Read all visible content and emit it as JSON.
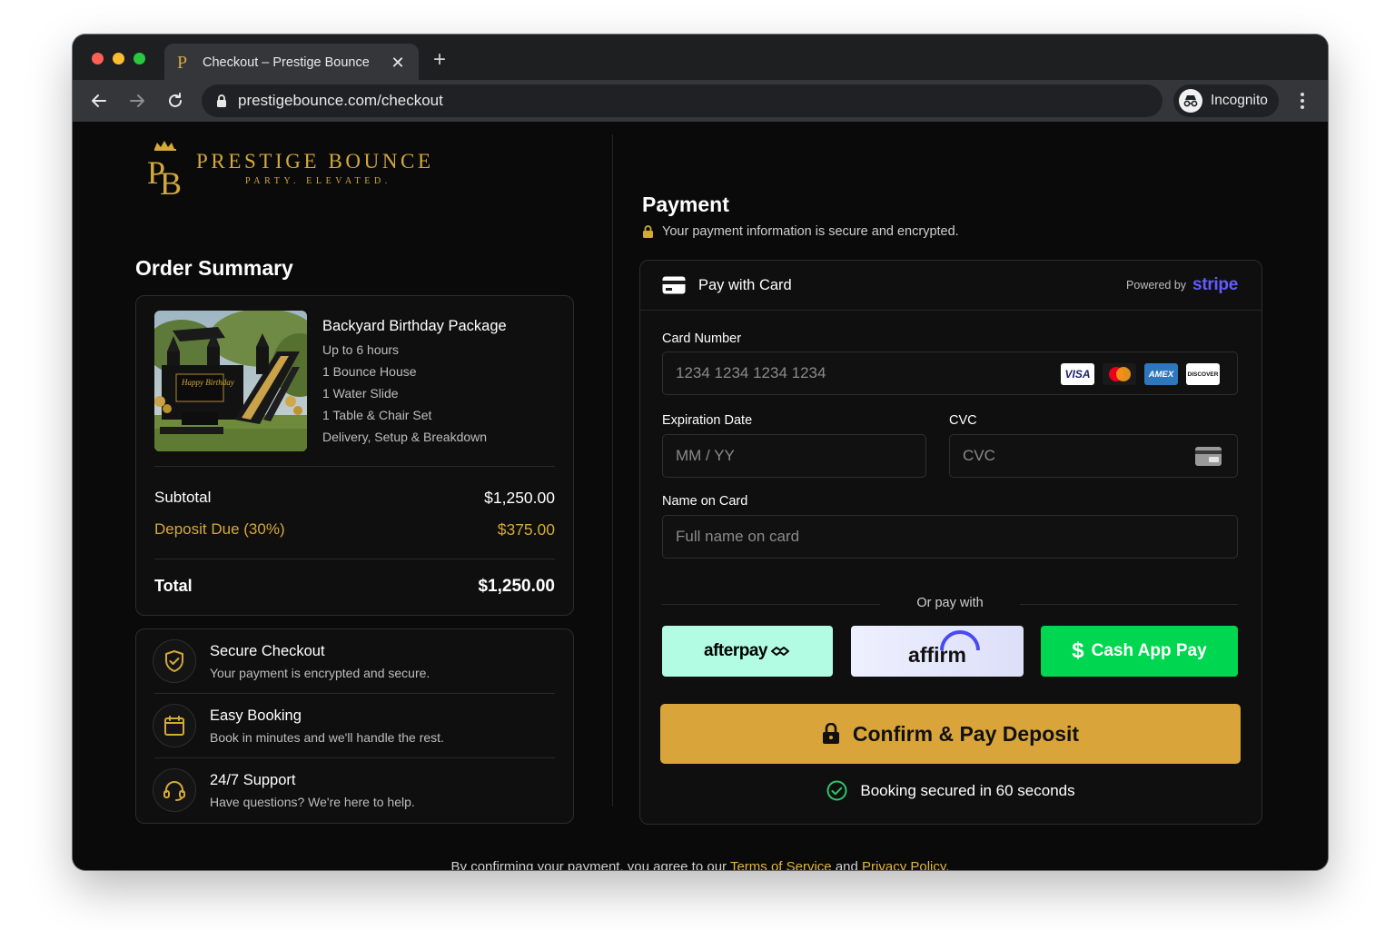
{
  "browser": {
    "tab_title": "Checkout – Prestige Bounce",
    "tab_favicon": "P",
    "url": "prestigebounce.com/checkout",
    "incognito_label": "Incognito"
  },
  "brand": {
    "name": "PRESTIGE BOUNCE",
    "tagline": "PARTY. ELEVATED.",
    "monogram_letters": "PB",
    "gold": "#d4a93a"
  },
  "order_summary": {
    "heading": "Order Summary",
    "product": {
      "title": "Backyard Birthday Package",
      "details": [
        "Up to 6 hours",
        "1 Bounce House",
        "1 Water Slide",
        "1 Table & Chair Set",
        "Delivery, Setup & Breakdown"
      ],
      "image_sign": "Happy Birthday"
    },
    "subtotal_label": "Subtotal",
    "subtotal_value": "$1,250.00",
    "deposit_label": "Deposit Due (30%)",
    "deposit_value": "$375.00",
    "total_label": "Total",
    "total_value": "$1,250.00"
  },
  "features": [
    {
      "icon": "shield-check-icon",
      "title": "Secure Checkout",
      "subtitle": "Your payment is encrypted and secure."
    },
    {
      "icon": "calendar-icon",
      "title": "Easy Booking",
      "subtitle": "Book in minutes and we'll handle the rest."
    },
    {
      "icon": "headset-icon",
      "title": "24/7 Support",
      "subtitle": "Have questions? We're here to help."
    }
  ],
  "payment": {
    "heading": "Payment",
    "secure_note": "Your payment information is secure and encrypted.",
    "card_header": "Pay with Card",
    "powered_by": "Powered by",
    "stripe": "stripe",
    "card_number_label": "Card Number",
    "card_number_placeholder": "1234 1234 1234 1234",
    "card_brands": [
      "VISA",
      "Mastercard",
      "AMEX",
      "DISCOVER"
    ],
    "expiry_label": "Expiration Date",
    "expiry_placeholder": "MM / YY",
    "cvc_label": "CVC",
    "cvc_placeholder": "CVC",
    "name_label": "Name on Card",
    "name_placeholder": "Full name on card",
    "or_pay_with": "Or pay with",
    "afterpay": "afterpay",
    "affirm": "affirm",
    "cashapp": "Cash App Pay",
    "confirm_button": "Confirm & Pay Deposit",
    "secured_note": "Booking secured in 60 seconds"
  },
  "footer": {
    "prefix": "By confirming your payment, you agree to our",
    "terms": "Terms of Service",
    "and": "and",
    "privacy": "Privacy Policy",
    "suffix": "."
  },
  "colors": {
    "page_bg": "#0a0a0a",
    "accent_gold": "#d9a53a",
    "afterpay_bg": "#b2fce4",
    "cashapp_bg": "#00d64f",
    "stripe": "#635bff"
  }
}
